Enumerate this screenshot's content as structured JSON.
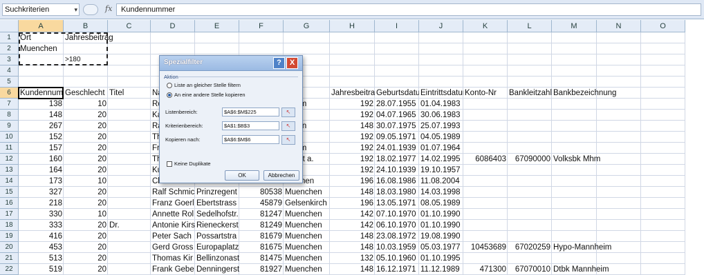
{
  "formula_bar": {
    "name_box": "Suchkriterien",
    "name_box_arrow": "▾",
    "fx": "fx",
    "content": "Kundennummer"
  },
  "columns": [
    "A",
    "B",
    "C",
    "D",
    "E",
    "F",
    "G",
    "H",
    "I",
    "J",
    "K",
    "L",
    "M",
    "N",
    "O"
  ],
  "row_numbers": [
    "1",
    "2",
    "3",
    "4",
    "5",
    "6",
    "7",
    "8",
    "9",
    "10",
    "11",
    "12",
    "13",
    "14",
    "15",
    "16",
    "17",
    "18",
    "19",
    "20",
    "21",
    "22"
  ],
  "criteria": {
    "A1": "Ort",
    "B1": "Jahresbeitrag",
    "A2": "Muenchen",
    "B3": ">180"
  },
  "headers": {
    "A": "Kundennummer",
    "B": "Geschlecht",
    "C": "Titel",
    "D": "Name",
    "H": "Jahresbeitrag",
    "I": "Geburtsdatum",
    "J": "Eintrittsdatum",
    "K": "Konto-Nr",
    "L": "Bankleitzahl",
    "M": "Bankbezeichnung"
  },
  "rows": [
    {
      "A": "138",
      "B": "10",
      "C": "",
      "D": "Ros",
      "E": "",
      "F": "",
      "G": "nheim",
      "H": "192",
      "I": "28.07.1955",
      "J": "01.04.1983",
      "K": "",
      "L": "",
      "M": ""
    },
    {
      "A": "148",
      "B": "20",
      "C": "",
      "D": "Karl",
      "E": "",
      "F": "",
      "G": "sdorf",
      "H": "192",
      "I": "04.07.1965",
      "J": "30.06.1983",
      "K": "",
      "L": "",
      "M": ""
    },
    {
      "A": "267",
      "B": "20",
      "C": "",
      "D": "Ralf",
      "E": "",
      "F": "",
      "G": "nchen",
      "H": "148",
      "I": "30.07.1975",
      "J": "25.07.1993",
      "K": "",
      "L": "",
      "M": ""
    },
    {
      "A": "152",
      "B": "20",
      "C": "",
      "D": "Thor",
      "E": "",
      "F": "",
      "G": "her",
      "H": "192",
      "I": "09.05.1971",
      "J": "04.05.1989",
      "K": "",
      "L": "",
      "M": ""
    },
    {
      "A": "157",
      "B": "20",
      "C": "",
      "D": "Frie",
      "E": "",
      "F": "",
      "G": "nheim",
      "H": "192",
      "I": "24.01.1939",
      "J": "01.07.1964",
      "K": "",
      "L": "",
      "M": ""
    },
    {
      "A": "160",
      "B": "20",
      "C": "",
      "D": "Thor",
      "E": "",
      "F": "",
      "G": "nkfurt a.",
      "H": "192",
      "I": "18.02.1977",
      "J": "14.02.1995",
      "K": "6086403",
      "L": "67090000",
      "M": "Volksbk Mhm"
    },
    {
      "A": "164",
      "B": "20",
      "C": "",
      "D": "Kurt",
      "E": "",
      "F": "",
      "G": "tgart",
      "H": "192",
      "I": "24.10.1939",
      "J": "19.10.1957",
      "K": "",
      "L": "",
      "M": ""
    },
    {
      "A": "173",
      "B": "10",
      "C": "",
      "D": "Claudia Deir",
      "E": "Baumschule",
      "F": "50226",
      "G": "Frechen",
      "H": "196",
      "I": "16.08.1986",
      "J": "11.08.2004",
      "K": "",
      "L": "",
      "M": ""
    },
    {
      "A": "327",
      "B": "20",
      "C": "",
      "D": "Ralf Schmic",
      "E": "Prinzregent",
      "F": "80538",
      "G": "Muenchen",
      "H": "148",
      "I": "18.03.1980",
      "J": "14.03.1998",
      "K": "",
      "L": "",
      "M": ""
    },
    {
      "A": "218",
      "B": "20",
      "C": "",
      "D": "Franz Goerl",
      "E": "Ebertstrass",
      "F": "45879",
      "G": "Gelsenkirch",
      "H": "196",
      "I": "13.05.1971",
      "J": "08.05.1989",
      "K": "",
      "L": "",
      "M": ""
    },
    {
      "A": "330",
      "B": "10",
      "C": "",
      "D": "Annette Rol",
      "E": "Sedelhofstr.",
      "F": "81247",
      "G": "Muenchen",
      "H": "142",
      "I": "07.10.1970",
      "J": "01.10.1990",
      "K": "",
      "L": "",
      "M": ""
    },
    {
      "A": "333",
      "B": "20",
      "C": "Dr.",
      "D": "Antonie Kirs",
      "E": "Rieneckerst",
      "F": "81249",
      "G": "Muenchen",
      "H": "142",
      "I": "06.10.1970",
      "J": "01.10.1990",
      "K": "",
      "L": "",
      "M": ""
    },
    {
      "A": "416",
      "B": "20",
      "C": "",
      "D": "Peter Sach",
      "E": "Possartstra",
      "F": "81679",
      "G": "Muenchen",
      "H": "148",
      "I": "23.08.1972",
      "J": "19.08.1990",
      "K": "",
      "L": "",
      "M": ""
    },
    {
      "A": "453",
      "B": "20",
      "C": "",
      "D": "Gerd Gross",
      "E": "Europaplatz",
      "F": "81675",
      "G": "Muenchen",
      "H": "148",
      "I": "10.03.1959",
      "J": "05.03.1977",
      "K": "10453689",
      "L": "67020259",
      "M": "Hypo-Mannheim"
    },
    {
      "A": "513",
      "B": "20",
      "C": "",
      "D": "Thomas Kir",
      "E": "Bellinzonast",
      "F": "81475",
      "G": "Muenchen",
      "H": "132",
      "I": "05.10.1960",
      "J": "01.10.1995",
      "K": "",
      "L": "",
      "M": ""
    },
    {
      "A": "519",
      "B": "20",
      "C": "",
      "D": "Frank Gebe",
      "E": "Denningerst",
      "F": "81927",
      "G": "Muenchen",
      "H": "148",
      "I": "16.12.1971",
      "J": "11.12.1989",
      "K": "471300",
      "L": "67070010",
      "M": "Dtbk Mannheim"
    }
  ],
  "dialog": {
    "title": "Spezialfilter",
    "help": "?",
    "close": "X",
    "group": "Aktion",
    "radio1": "Liste an gleicher Stelle filtern",
    "radio2": "An eine andere Stelle kopieren",
    "label_list": "Listenbereich:",
    "label_criteria": "Kriterienbereich:",
    "label_copy": "Kopieren nach:",
    "value_list": "$A$6:$M$225",
    "value_criteria": "$A$1:$B$3",
    "value_copy": "$A$6:$M$6",
    "checkbox": "Keine Duplikate",
    "ok": "OK",
    "cancel": "Abbrechen"
  }
}
